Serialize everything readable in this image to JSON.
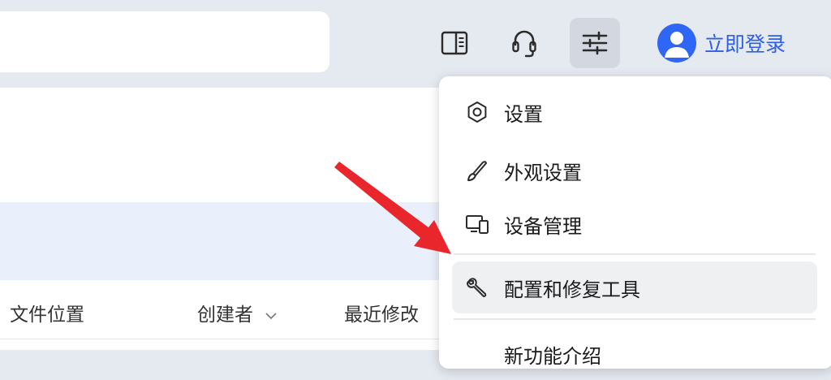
{
  "topbar": {
    "search_placeholder": "",
    "icons": [
      "sidebar-panel-icon",
      "headset-icon",
      "sliders-icon"
    ],
    "login_label": "立即登录"
  },
  "table": {
    "columns": [
      {
        "label": "文件位置"
      },
      {
        "label": "创建者",
        "sortable": true
      },
      {
        "label": "最近修改"
      }
    ]
  },
  "menu": {
    "items": [
      {
        "label": "设置",
        "icon": "gear-icon"
      },
      {
        "label": "外观设置",
        "icon": "brush-icon"
      },
      {
        "label": "设备管理",
        "icon": "devices-icon"
      },
      {
        "label": "配置和修复工具",
        "icon": "wrench-icon",
        "hovered": true
      },
      {
        "label": "新功能介绍",
        "icon": "",
        "partially_visible": true
      }
    ]
  },
  "colors": {
    "accent": "#2f66f5",
    "topbar_bg": "#e5e9f0",
    "highlight_row": "#eaf0fb",
    "arrow": "#e8262b"
  }
}
